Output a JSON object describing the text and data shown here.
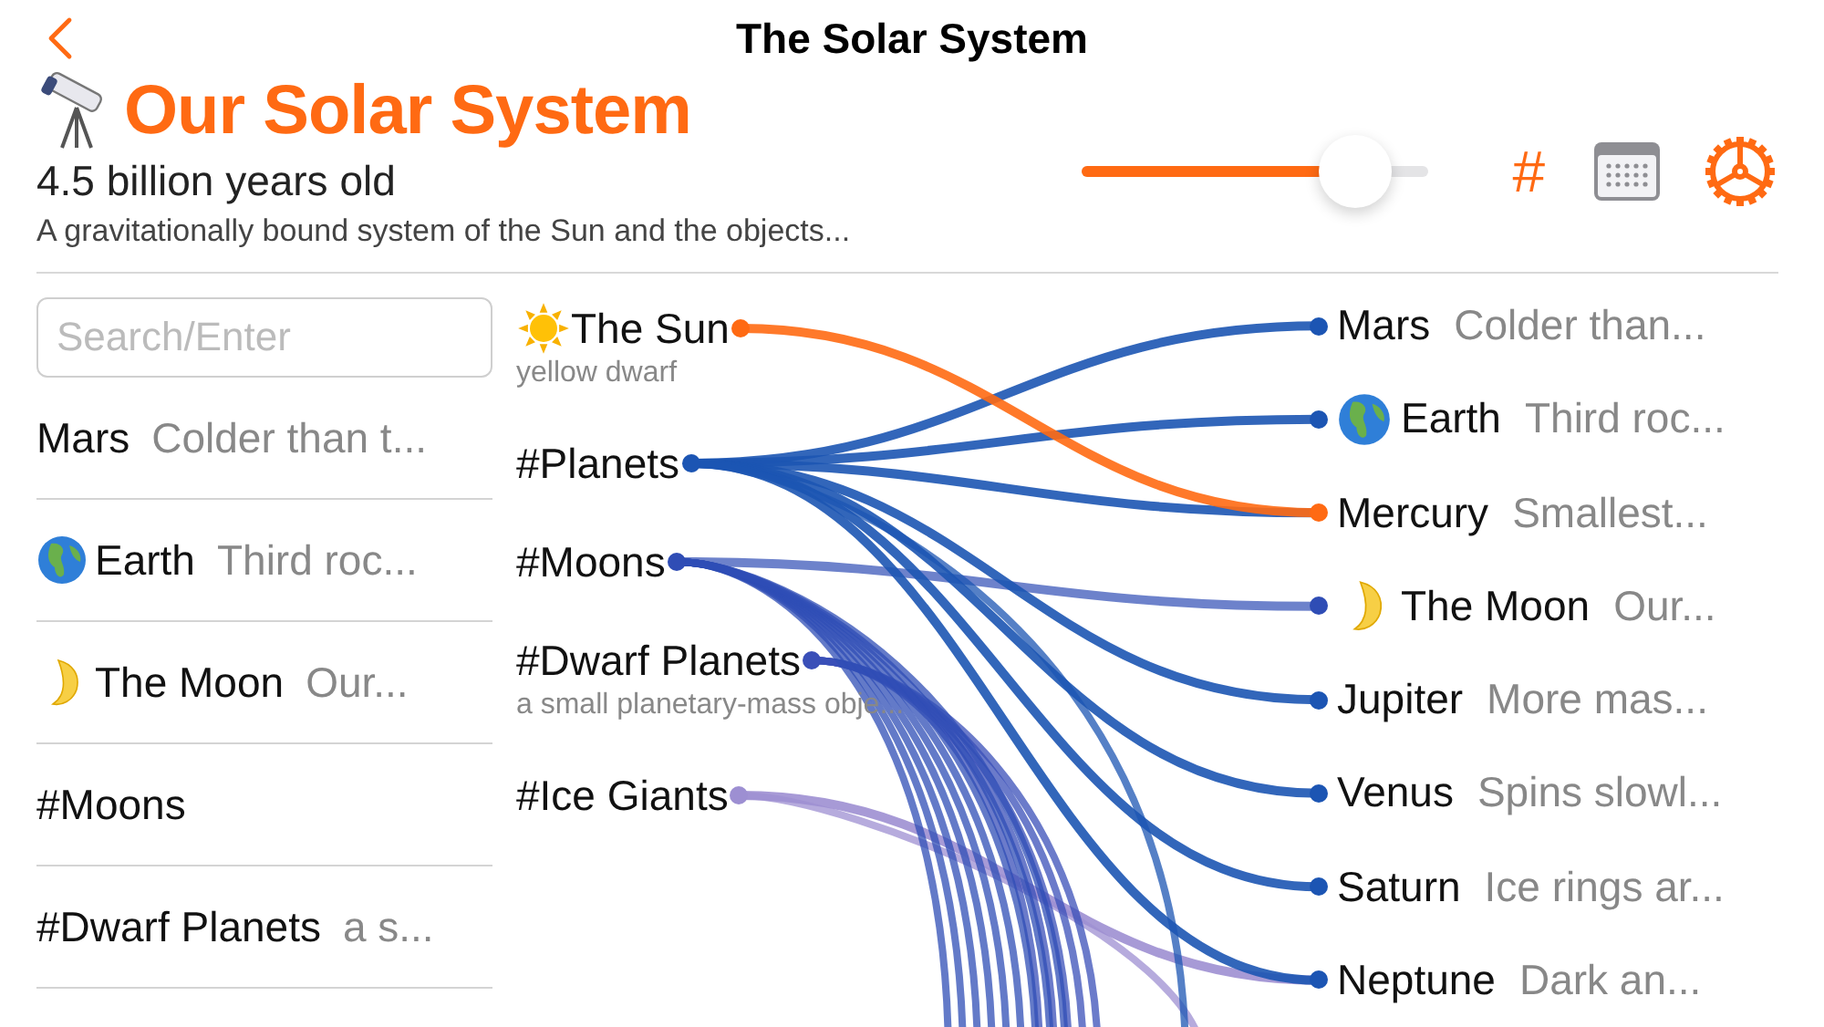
{
  "nav": {
    "title": "The Solar System"
  },
  "header": {
    "title": "Our Solar System",
    "subtitle": "4.5 billion years old",
    "description": "A gravitationally bound system of the Sun and the objects..."
  },
  "toolbar": {
    "slider": {
      "level": 0.79
    },
    "tag_button": "#"
  },
  "search": {
    "placeholder": "Search/Enter"
  },
  "list": [
    {
      "kind": "plain",
      "name": "Mars",
      "detail": "Colder than t..."
    },
    {
      "kind": "globe",
      "name": "Earth",
      "detail": "Third roc..."
    },
    {
      "kind": "moon",
      "name": "The Moon",
      "detail": "Our..."
    },
    {
      "kind": "plain",
      "name": "#Moons"
    },
    {
      "kind": "plain",
      "name": "#Dwarf Planets",
      "detail": "a s..."
    }
  ],
  "graph": {
    "sources": [
      {
        "kind": "sun",
        "label": "The Sun",
        "sub": "yellow dwarf",
        "color": "#ff6a13"
      },
      {
        "kind": "plain",
        "label": "#Planets",
        "color": "#1c55b3"
      },
      {
        "kind": "plain",
        "label": "#Moons",
        "color": "#2f4db5"
      },
      {
        "kind": "plain",
        "label": "#Dwarf Planets",
        "sub": "a small planetary-mass obje...",
        "color": "#3a4fb8"
      },
      {
        "kind": "plain",
        "label": "#Ice Giants",
        "color": "#9d8fd2"
      }
    ],
    "items": [
      {
        "kind": "plain",
        "name": "Mars",
        "detail": "Colder than..."
      },
      {
        "kind": "globe",
        "name": "Earth",
        "detail": "Third roc..."
      },
      {
        "kind": "plain",
        "name": "Mercury",
        "detail": "Smallest..."
      },
      {
        "kind": "moon",
        "name": "The Moon",
        "detail": "Our..."
      },
      {
        "kind": "plain",
        "name": "Jupiter",
        "detail": "More mas..."
      },
      {
        "kind": "plain",
        "name": "Venus",
        "detail": "Spins slowl..."
      },
      {
        "kind": "plain",
        "name": "Saturn",
        "detail": "Ice rings ar..."
      },
      {
        "kind": "plain",
        "name": "Neptune",
        "detail": "Dark an..."
      }
    ]
  }
}
